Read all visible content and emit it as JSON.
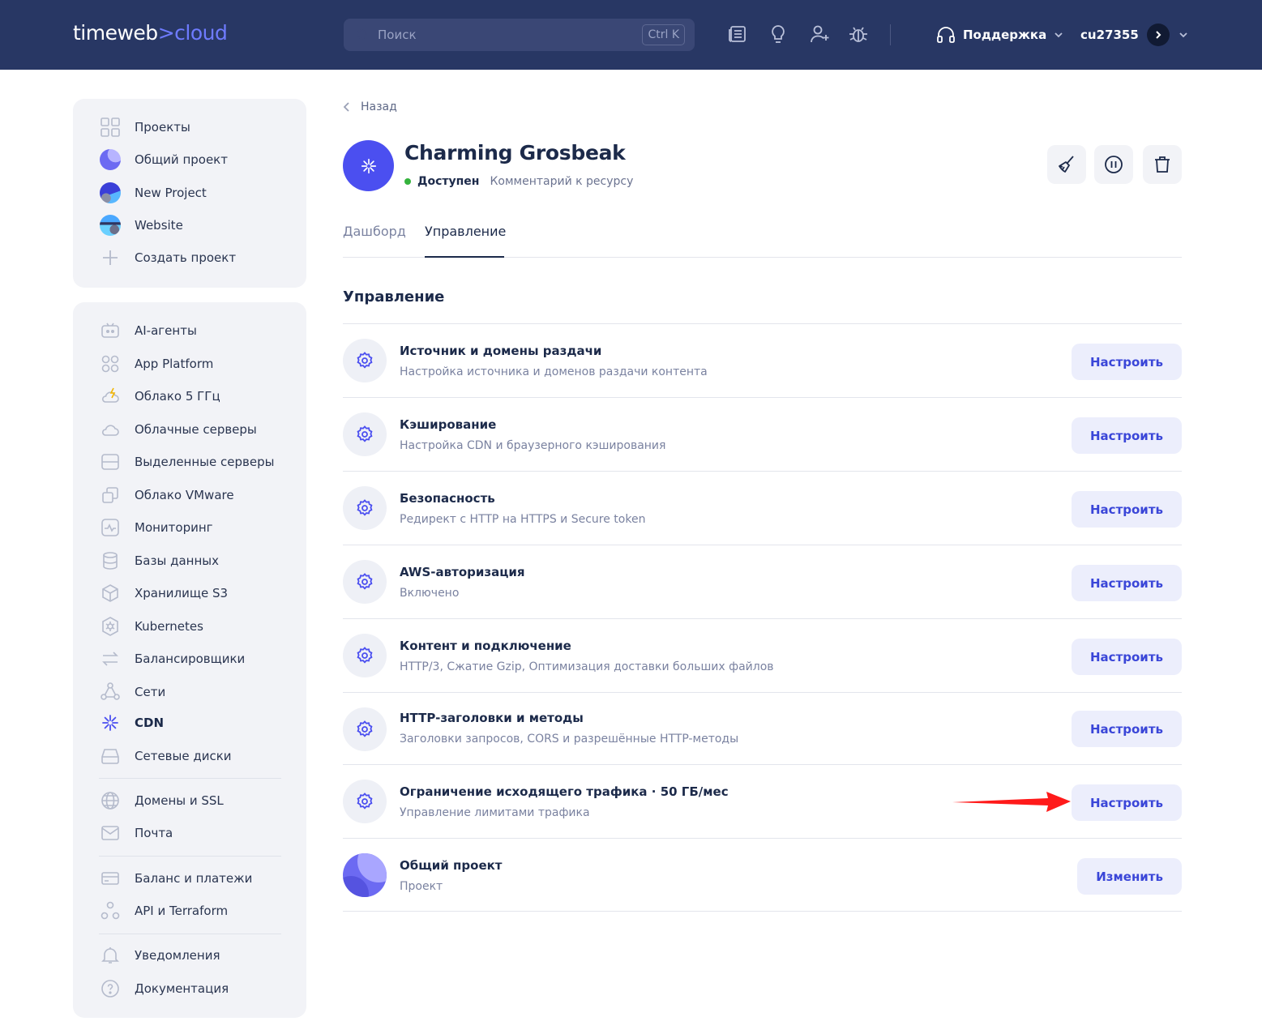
{
  "header": {
    "logo_main": "timeweb",
    "logo_accent": ">cloud",
    "search_placeholder": "Поиск",
    "search_shortcut": "Ctrl K",
    "support_label": "Поддержка",
    "account_name": "cu27355"
  },
  "projects_nav": {
    "items": [
      {
        "label": "Проекты",
        "icon": "grid-icon"
      },
      {
        "label": "Общий проект",
        "icon": "project-avatar"
      },
      {
        "label": "New Project",
        "icon": "project-avatar"
      },
      {
        "label": "Website",
        "icon": "project-avatar"
      },
      {
        "label": "Создать проект",
        "icon": "plus-icon"
      }
    ]
  },
  "services_nav": {
    "items": [
      {
        "label": "AI-агенты",
        "icon": "robot-icon"
      },
      {
        "label": "App Platform",
        "icon": "apps-icon"
      },
      {
        "label": "Облако 5 ГГц",
        "icon": "cloud-bolt-icon"
      },
      {
        "label": "Облачные серверы",
        "icon": "cloud-icon"
      },
      {
        "label": "Выделенные серверы",
        "icon": "server-icon"
      },
      {
        "label": "Облако VMware",
        "icon": "vmware-icon"
      },
      {
        "label": "Мониторинг",
        "icon": "monitoring-icon"
      },
      {
        "label": "Базы данных",
        "icon": "database-icon"
      },
      {
        "label": "Хранилище S3",
        "icon": "cube-icon"
      },
      {
        "label": "Kubernetes",
        "icon": "kubernetes-icon"
      },
      {
        "label": "Балансировщики",
        "icon": "balancer-icon"
      },
      {
        "label": "Сети",
        "icon": "network-icon"
      },
      {
        "label": "CDN",
        "icon": "cdn-icon"
      },
      {
        "label": "Сетевые диски",
        "icon": "disk-icon"
      },
      {
        "label": "Домены и SSL",
        "icon": "globe-icon"
      },
      {
        "label": "Почта",
        "icon": "mail-icon"
      },
      {
        "label": "Баланс и платежи",
        "icon": "card-icon"
      },
      {
        "label": "API и Terraform",
        "icon": "api-icon"
      },
      {
        "label": "Уведомления",
        "icon": "bell-icon"
      },
      {
        "label": "Документация",
        "icon": "help-icon"
      }
    ],
    "active": "CDN"
  },
  "page": {
    "back_label": "Назад",
    "title": "Charming Grosbeak",
    "status": "Доступен",
    "comment_link": "Комментарий к ресурсу",
    "tabs": [
      "Дашборд",
      "Управление"
    ],
    "active_tab": "Управление",
    "section_title": "Управление"
  },
  "settings_rows": [
    {
      "title": "Источник и домены раздачи",
      "subtitle": "Настройка источника и доменов раздачи контента",
      "button": "Настроить"
    },
    {
      "title": "Кэширование",
      "subtitle": "Настройка CDN и браузерного кэширования",
      "button": "Настроить"
    },
    {
      "title": "Безопасность",
      "subtitle": "Редирект с HTTP на HTTPS и Secure token",
      "button": "Настроить"
    },
    {
      "title": "AWS-авторизация",
      "subtitle": "Включено",
      "button": "Настроить"
    },
    {
      "title": "Контент и подключение",
      "subtitle": "HTTP/3, Сжатие Gzip, Оптимизация доставки больших файлов",
      "button": "Настроить"
    },
    {
      "title": "HTTP-заголовки и методы",
      "subtitle": "Заголовки запросов, CORS и разрешённые HTTP-методы",
      "button": "Настроить"
    },
    {
      "title": "Ограничение исходящего трафика · 50 ГБ/мес",
      "subtitle": "Управление лимитами трафика",
      "button": "Настроить"
    },
    {
      "title": "Общий проект",
      "subtitle": "Проект",
      "button": "Изменить"
    }
  ],
  "colors": {
    "header_bg": "#283764",
    "accent": "#4b4ff0",
    "button_bg": "#eceefc",
    "button_text": "#3a46d8",
    "status_green": "#35b33d",
    "annotation_arrow": "#ff1a1a"
  }
}
